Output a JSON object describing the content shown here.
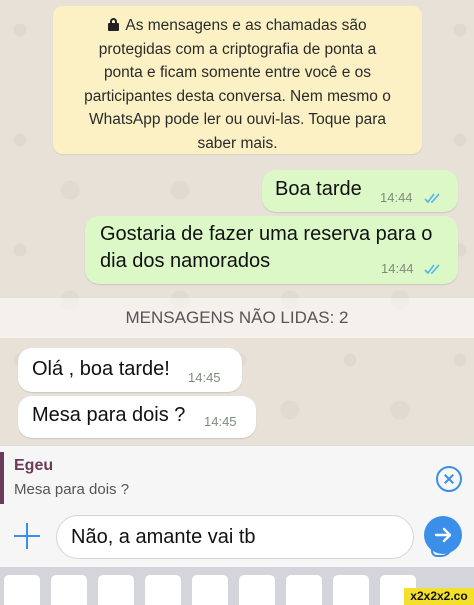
{
  "encryption_notice": {
    "lines": [
      "As mensagens e as chamadas são",
      "protegidas com a criptografia de ponta a",
      "ponta e ficam somente entre você e os",
      "participantes desta conversa. Nem mesmo o",
      "WhatsApp pode ler ou ouvi-las. Toque para",
      "saber mais."
    ]
  },
  "messages": {
    "out_1": {
      "text": "Boa tarde",
      "time": "14:44"
    },
    "out_2": {
      "line1": "Gostaria de fazer uma reserva para o",
      "line2": "dia dos namorados",
      "time": "14:44"
    },
    "unread_label": "MENSAGENS NÃO LIDAS: 2",
    "in_1": {
      "text": "Olá , boa tarde!",
      "time": "14:45"
    },
    "in_2": {
      "text": "Mesa para dois ?",
      "time": "14:45"
    }
  },
  "reply": {
    "name": "Egeu",
    "quoted": "Mesa para dois ?"
  },
  "composer": {
    "value": "Não, a amante vai tb"
  },
  "watermark": "x2x2x2.co",
  "icons": {
    "lock": "lock-icon",
    "read_ticks": "double-check-icon",
    "close": "close-circle-icon",
    "attach": "plus-icon",
    "sticker": "sticker-icon",
    "send": "send-arrow-icon"
  },
  "colors": {
    "outgoing_bubble": "#dcf8c6",
    "incoming_bubble": "#ffffff",
    "notice_bg": "#fbf1c4",
    "accent_blue": "#3b8fe8",
    "reply_name": "#6b3b5a"
  }
}
